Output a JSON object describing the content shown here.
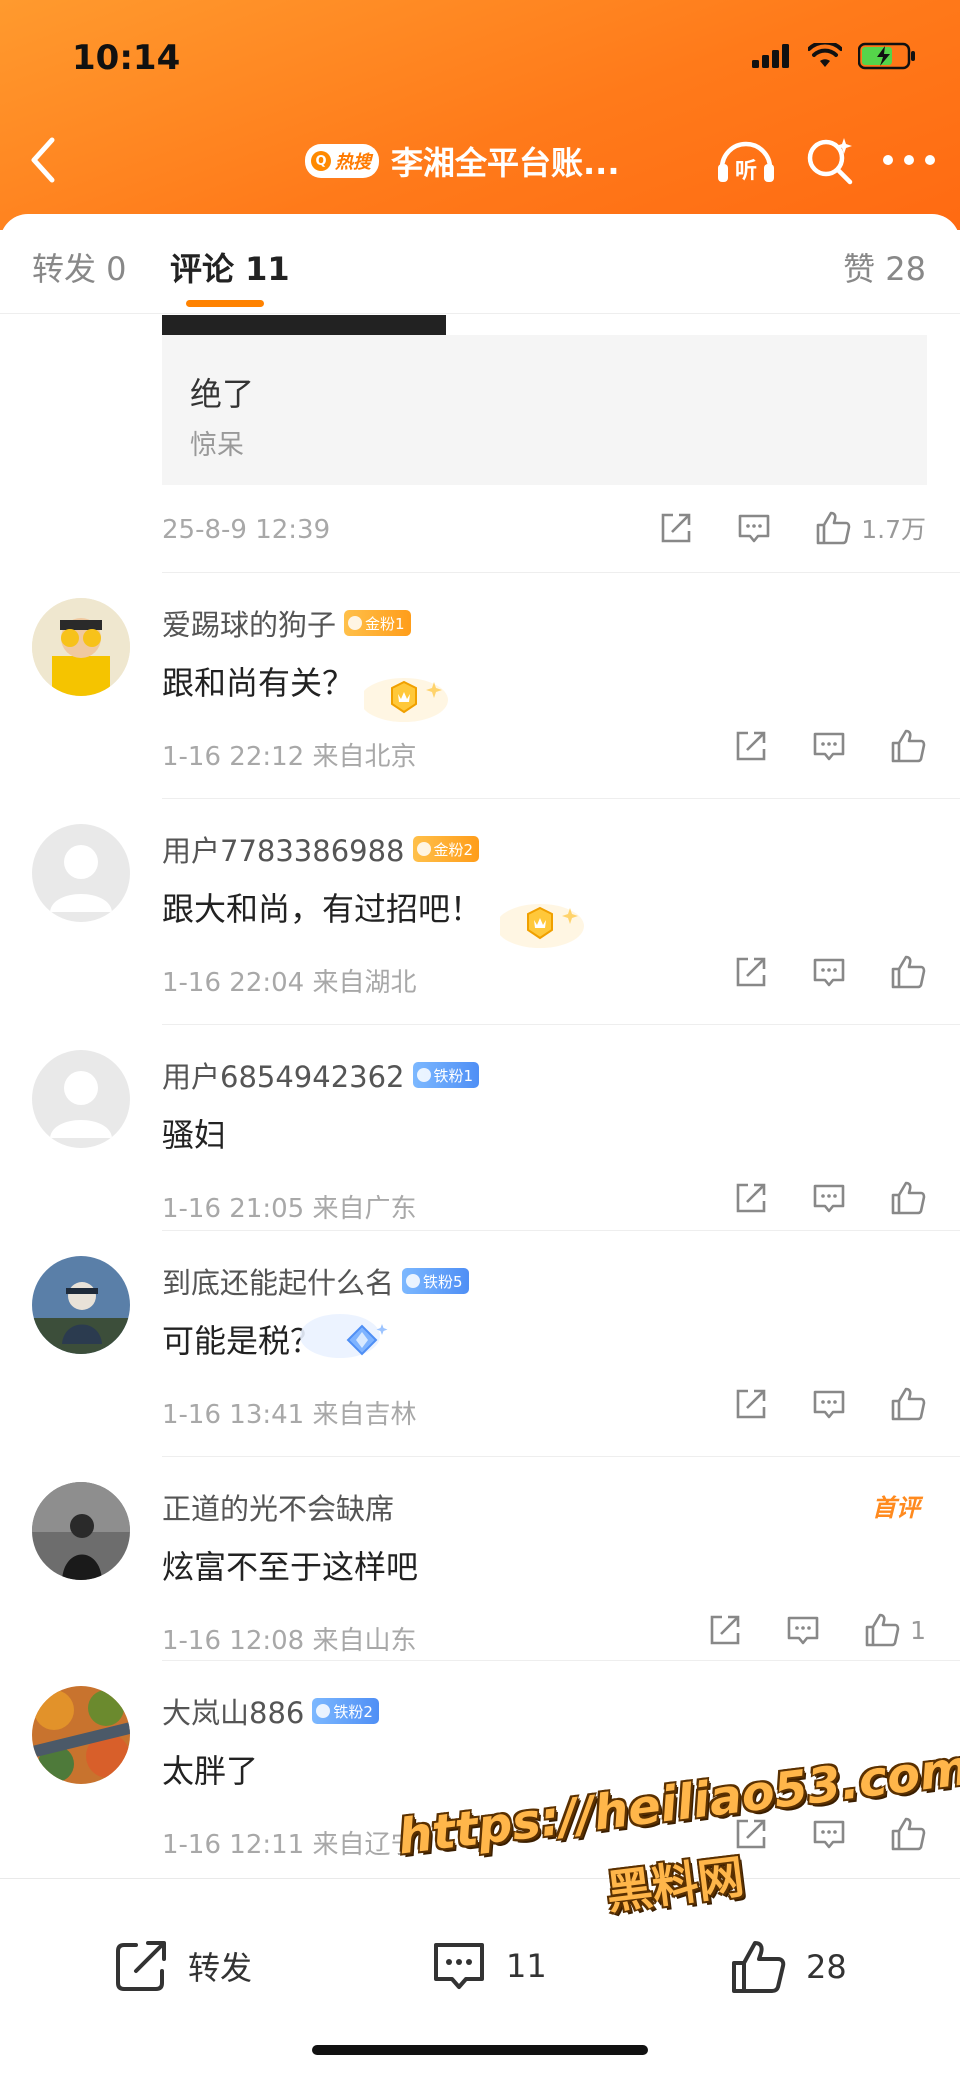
{
  "status_bar": {
    "time": "10:14"
  },
  "nav": {
    "hot_tag": "热搜",
    "title": "李湘全平台账...",
    "listen_label": "听"
  },
  "tabs": [
    {
      "label": "转发 0"
    },
    {
      "label": "评论 11"
    },
    {
      "label": "赞 28"
    }
  ],
  "top_comment": {
    "quote_main": "绝了",
    "quote_sub": "惊呆",
    "meta": "25-8-9 12:39",
    "like_count": "1.7万"
  },
  "comments": [
    {
      "name": "爱踢球的狗子",
      "badge": "金粉1",
      "badge_type": "gold",
      "text": "跟和尚有关？",
      "meta": "1-16 22:12 来自北京",
      "likes": ""
    },
    {
      "name": "用户7783386988",
      "badge": "金粉2",
      "badge_type": "gold",
      "text": "跟大和尚，有过招吧！",
      "meta": "1-16 22:04 来自湖北",
      "likes": ""
    },
    {
      "name": "用户6854942362",
      "badge": "铁粉1",
      "badge_type": "iron",
      "text": "骚妇",
      "meta": "1-16 21:05 来自广东",
      "likes": ""
    },
    {
      "name": "到底还能起什么名",
      "badge": "铁粉5",
      "badge_type": "iron",
      "text": "可能是税？",
      "meta": "1-16 13:41 来自吉林",
      "likes": ""
    },
    {
      "name": "正道的光不会缺席",
      "badge": "",
      "badge_type": "",
      "text": "炫富不至于这样吧",
      "meta": "1-16 12:08 来自山东",
      "likes": "1",
      "first_label": "首评"
    },
    {
      "name": "大岚山886",
      "badge": "铁粉2",
      "badge_type": "iron",
      "text": "太胖了",
      "meta": "1-16 12:11 来自辽宁",
      "likes": ""
    }
  ],
  "bottom_bar": {
    "repost_label": "转发",
    "comment_count": "11",
    "like_count": "28"
  },
  "watermark": {
    "url": "https://heiliao53.com",
    "name": "黑料网"
  },
  "colors": {
    "header": "#ff7a1a",
    "accent": "#ff8200",
    "gold_badge": "#ffa52a",
    "iron_badge": "#5a97f7"
  }
}
